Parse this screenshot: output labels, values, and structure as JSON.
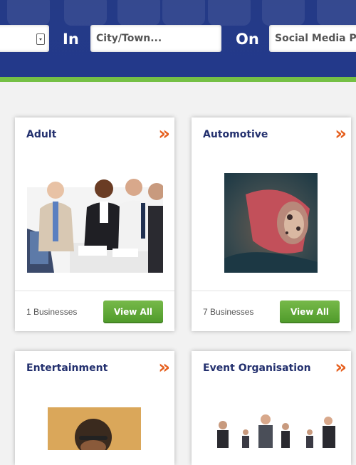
{
  "search": {
    "keyword_value": "",
    "in_label": "In",
    "city_placeholder": "City/Town...",
    "on_label": "On",
    "social_value": "Social Media Profile"
  },
  "colors": {
    "header_blue": "#23398b",
    "accent_green": "#75c045",
    "title_navy": "#23306e",
    "chevron_orange": "#e6601f"
  },
  "categories": [
    {
      "title": "Adult",
      "count": "1 Businesses",
      "button": "View All",
      "chevron": "»"
    },
    {
      "title": "Automotive",
      "count": "7 Businesses",
      "button": "View All",
      "chevron": "»"
    },
    {
      "title": "Entertainment",
      "chevron": "»"
    },
    {
      "title": "Event Organisation",
      "chevron": "»"
    }
  ]
}
